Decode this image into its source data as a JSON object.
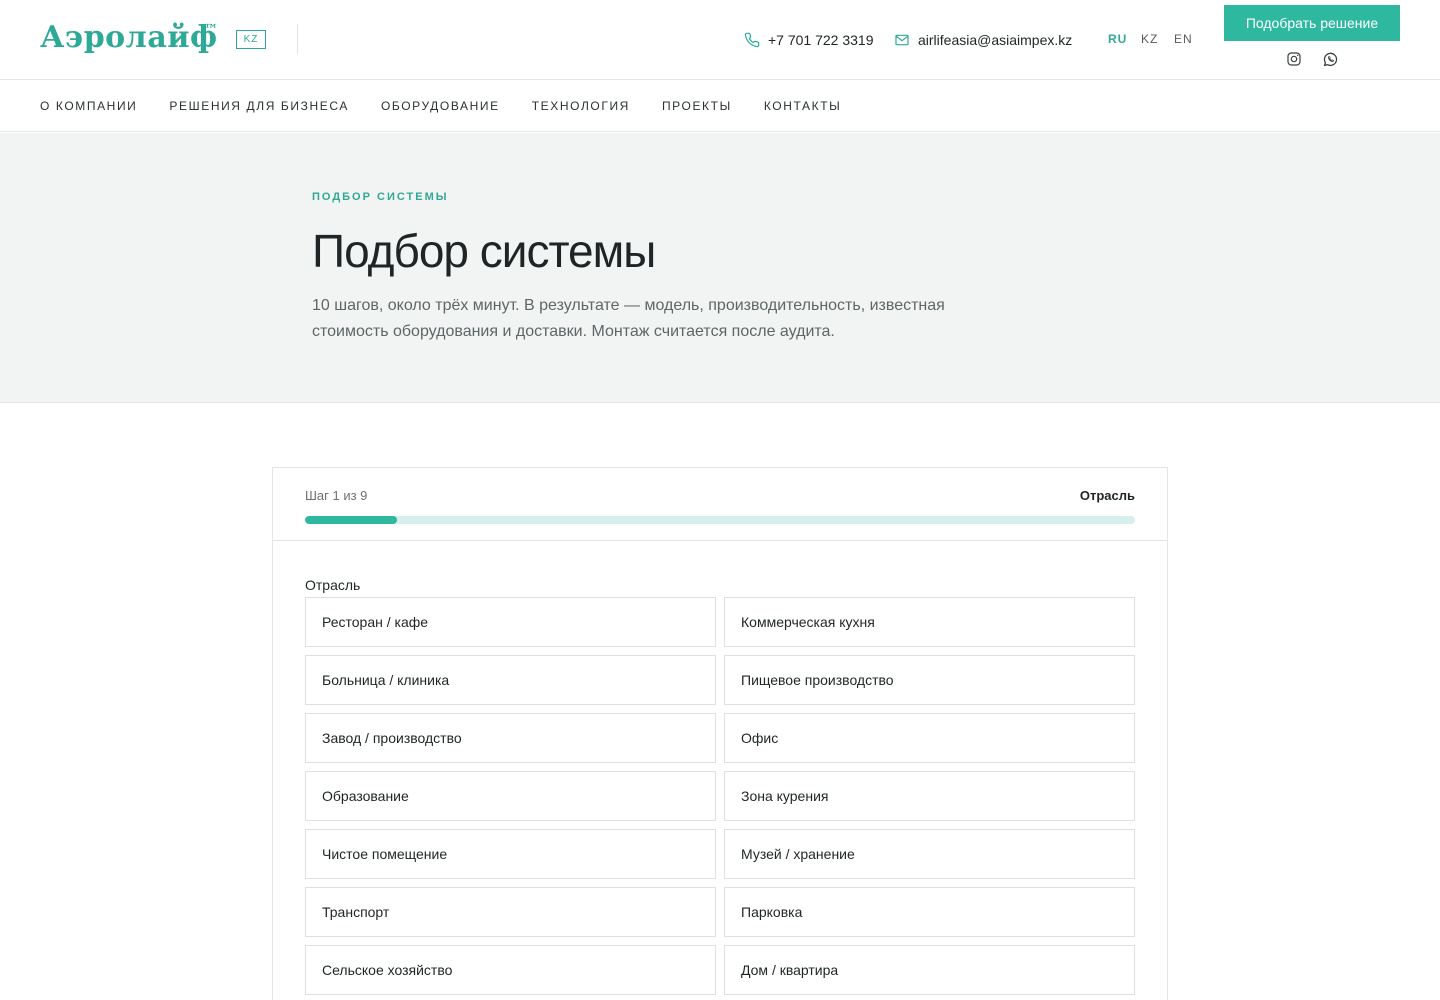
{
  "header": {
    "logo": "Аэролайф",
    "logo_tm": "™",
    "region_badge": "KZ",
    "phone": "+7 701 722 3319",
    "email": "airlifeasia@asiaimpex.kz",
    "languages": [
      {
        "code": "RU",
        "active": true
      },
      {
        "code": "KZ",
        "active": false
      },
      {
        "code": "EN",
        "active": false
      }
    ],
    "cta_label": "Подобрать решение",
    "social": [
      "instagram-icon",
      "whatsapp-icon"
    ]
  },
  "nav": {
    "items": [
      {
        "label": "О компании"
      },
      {
        "label": "Решения для бизнеса"
      },
      {
        "label": "Оборудование"
      },
      {
        "label": "Технология"
      },
      {
        "label": "Проекты"
      },
      {
        "label": "Контакты"
      }
    ]
  },
  "hero": {
    "eyebrow": "ПОДБОР СИСТЕМЫ",
    "title": "Подбор системы",
    "subtitle": "10 шагов, около трёх минут. В результате — модель, производительность, известная стоимость оборудования и доставки. Монтаж считается после аудита."
  },
  "wizard": {
    "step_label": "Шаг 1 из 9",
    "step_name": "Отрасль",
    "progress": 0.111,
    "field_label": "Отрасль",
    "options": [
      "Ресторан / кафе",
      "Коммерческая кухня",
      "Больница / клиника",
      "Пищевое производство",
      "Завод / производство",
      "Офис",
      "Образование",
      "Зона курения",
      "Чистое помещение",
      "Музей / хранение",
      "Транспорт",
      "Парковка",
      "Сельское хозяйство",
      "Дом / квартира"
    ]
  },
  "colors": {
    "accent": "#2fb8a0",
    "accent_text": "#2fa997",
    "progress_track": "#d6efea",
    "hero_bg": "#f2f4f3"
  }
}
